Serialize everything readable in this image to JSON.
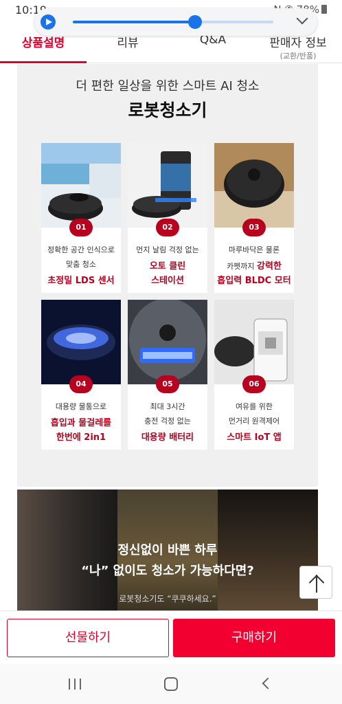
{
  "status_bar": {
    "time": "10:19",
    "indicators": "N ✆ 78%"
  },
  "media_player": {
    "progress": 0.61,
    "accent": "#1a73e8"
  },
  "tabs": [
    {
      "label": "상품설명",
      "sub": ""
    },
    {
      "label": "리뷰",
      "sub": ""
    },
    {
      "label": "Q&A",
      "sub": ""
    },
    {
      "label": "판매자 정보",
      "sub": "(교환/반품)"
    }
  ],
  "intro": {
    "subtitle": "더 편한 일상을 위한 스마트 AI 청소",
    "headline": "로봇청소기"
  },
  "features": [
    {
      "num": "01",
      "line1": "정확한 공간 인식으로",
      "line2": "맞춤 청소",
      "line3": "초정밀 LDS 센서"
    },
    {
      "num": "02",
      "line1": "먼지 날림 걱정 없는",
      "line2": "오토 클린",
      "line3": "스테이션"
    },
    {
      "num": "03",
      "line1": "마루바닥은 물론",
      "line2_plain": "카펫까지",
      "line2_bold": "강력한",
      "line3": "흡입력 BLDC 모터"
    },
    {
      "num": "04",
      "line1": "대용량 물통으로",
      "line2": "흡입과 물걸레를",
      "line3": "한번에 2in1"
    },
    {
      "num": "05",
      "line1": "최대 3시간",
      "line2": "충전 걱정 없는",
      "line3": "대용량 배터리"
    },
    {
      "num": "06",
      "line1": "여유를 위한",
      "line2": "먼거리 원격제어",
      "line3": "스마트 IoT 앱"
    }
  ],
  "banner": {
    "line1": "정신없이 바쁜 하루",
    "line2": "“나” 없이도 청소가 가능하다면?",
    "line3": "로봇청소기도 “쿠쿠하세요.”"
  },
  "buttons": {
    "gift": "선물하기",
    "buy": "구매하기"
  },
  "colors": {
    "brand_red": "#e0002b",
    "feature_red": "#b8001f"
  }
}
